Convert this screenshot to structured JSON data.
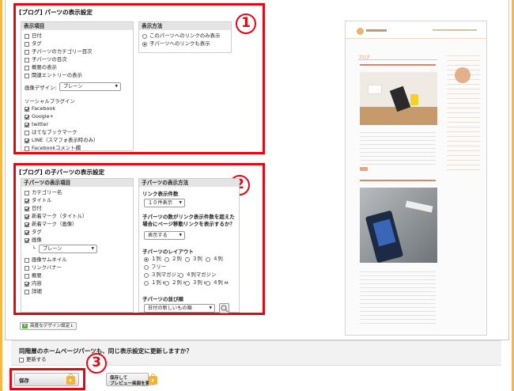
{
  "section1": {
    "title": "[ブログ] パーツの表示設定",
    "badge": "1",
    "display_items": {
      "header": "表示項目",
      "items": [
        {
          "label": "日付",
          "checked": false
        },
        {
          "label": "タグ",
          "checked": false
        },
        {
          "label": "子パーツのカテゴリー目次",
          "checked": false
        },
        {
          "label": "子パーツの目次",
          "checked": false
        },
        {
          "label": "概要の表示",
          "checked": false
        },
        {
          "label": "関連エントリーの表示",
          "checked": false
        }
      ],
      "image_design_label": "画像デザイン:",
      "image_design_value": "プレーン",
      "social_label": "ソーシャルプラグイン",
      "social": [
        {
          "label": "Facebook",
          "checked": true
        },
        {
          "label": "Google+",
          "checked": true
        },
        {
          "label": "twitter",
          "checked": true
        },
        {
          "label": "はてなブックマーク",
          "checked": false
        },
        {
          "label": "LINE（スマフォ表示時のみ）",
          "checked": true
        },
        {
          "label": "Facebookコメント欄",
          "checked": false
        }
      ]
    },
    "display_method": {
      "header": "表示方法",
      "options": [
        {
          "label": "このパーツへのリンクのみ表示",
          "selected": false
        },
        {
          "label": "子パーツへのリンクも表示",
          "selected": true
        }
      ]
    }
  },
  "section2": {
    "title": "[ブログ] の子パーツの表示設定",
    "badge": "2",
    "items": {
      "header": "子パーツの表示項目",
      "list_a": [
        {
          "label": "カテゴリー名",
          "checked": false
        },
        {
          "label": "タイトル",
          "checked": true
        },
        {
          "label": "日付",
          "checked": true
        },
        {
          "label": "新着マーク（タイトル）",
          "checked": true
        },
        {
          "label": "新着マーク（画像）",
          "checked": true
        },
        {
          "label": "タグ",
          "checked": true
        },
        {
          "label": "画像",
          "checked": true
        }
      ],
      "image_select": "プレーン",
      "list_b": [
        {
          "label": "画像サムネイル",
          "checked": false
        },
        {
          "label": "リンクバナー",
          "checked": false
        },
        {
          "label": "概要",
          "checked": false
        },
        {
          "label": "内容",
          "checked": true
        },
        {
          "label": "詳細",
          "checked": false
        }
      ]
    },
    "method": {
      "header": "子パーツの表示方法",
      "link_count_label": "リンク表示件数",
      "link_count_value": "１０件表示",
      "paging_label": "子パーツの数がリンク表示件数を超えた場合にページ移動リンクを表示するか？",
      "paging_value": "表示する",
      "layout_label": "子パーツのレイアウト",
      "layout_rows": [
        [
          {
            "label": "１列",
            "selected": true
          },
          {
            "label": "２列",
            "selected": false
          },
          {
            "label": "３列",
            "selected": false
          },
          {
            "label": "４列",
            "selected": false
          }
        ],
        [
          {
            "label": "フリー",
            "selected": false
          }
        ],
        [
          {
            "label": "３列マガジン",
            "selected": false
          },
          {
            "label": "４列マガジン",
            "selected": false
          }
        ],
        [
          {
            "label": "１列 ᴍ",
            "selected": false
          },
          {
            "label": "２列 ᴍ",
            "selected": false
          },
          {
            "label": "３列 ᴍ",
            "selected": false
          },
          {
            "label": "４列 ᴍ",
            "selected": false
          }
        ]
      ],
      "order_label": "子パーツの並び順",
      "order_value": "日付の新しいもの順"
    }
  },
  "advanced_link": "高度なデザイン設定",
  "update_question": "同階層のホームページパーツも、同じ表示設定に更新しますか？",
  "update_checkbox": "更新する",
  "badge3": "3",
  "save_button": "保存",
  "save_preview_line1": "保存して",
  "save_preview_line2": "プレビュー画面を更新",
  "preview": {
    "blog_heading": "ブログ"
  }
}
